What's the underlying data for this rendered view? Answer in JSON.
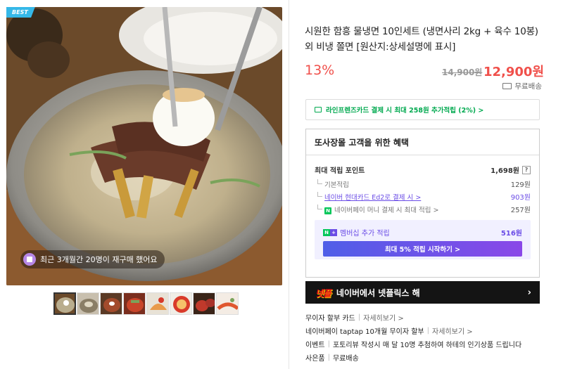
{
  "gallery": {
    "badge": "BEST",
    "repurchase_text": "최근 3개월간 20명이 재구매 했어요",
    "thumbnail_count": 8
  },
  "product": {
    "title": "시원한 함흥 물냉면 10인세트 (냉면사리 2kg + 육수 10봉) 외 비냉 쫄면 [원산지:상세설명에 표시]",
    "discount": "13%",
    "original_price": "14,900원",
    "price": "12,900원",
    "shipping": "무료배송"
  },
  "card_promo": "라인프렌즈카드 결제 시 최대 258원 추가적립 (2%) >",
  "benefits": {
    "heading": "또사장몰 고객을 위한 혜택",
    "max_points_label": "최대 적립 포인트",
    "max_points_value": "1,698원",
    "help": "?",
    "items": [
      {
        "label": "기본적립",
        "value": "129원"
      },
      {
        "label": "네이버 현대카드 Ed2로 결제 시 >",
        "value": "903원"
      },
      {
        "label": "네이버페이 머니 결제 시 최대 적립 >",
        "value": "257원",
        "badge": "N"
      }
    ],
    "membership": {
      "label": "멤버십 추가 적립",
      "badge_left": "N",
      "badge_right": "+",
      "value": "516원",
      "button": "최대 5% 적립 시작하기 >"
    }
  },
  "netflix": {
    "logo": "넷플",
    "text": "네이버에서 넷플릭스 해",
    "arrow": "›"
  },
  "info": [
    {
      "label": "무이자 할부 카드",
      "more": "자세히보기 >"
    },
    {
      "label": "네이버페이 taptap 10개월 무이자 할부",
      "more": "자세히보기 >"
    },
    {
      "label": "이벤트",
      "desc": "포토리뷰 작성시 매 달 10명 추첨하여 하테의 인기상품 드립니다"
    },
    {
      "label": "사은품",
      "desc": "무료배송"
    }
  ],
  "colors": {
    "accent_red": "#f0504b",
    "naver_green": "#00a94f",
    "membership_purple": "#6a4ce6",
    "best_badge": "#35b8e8"
  }
}
